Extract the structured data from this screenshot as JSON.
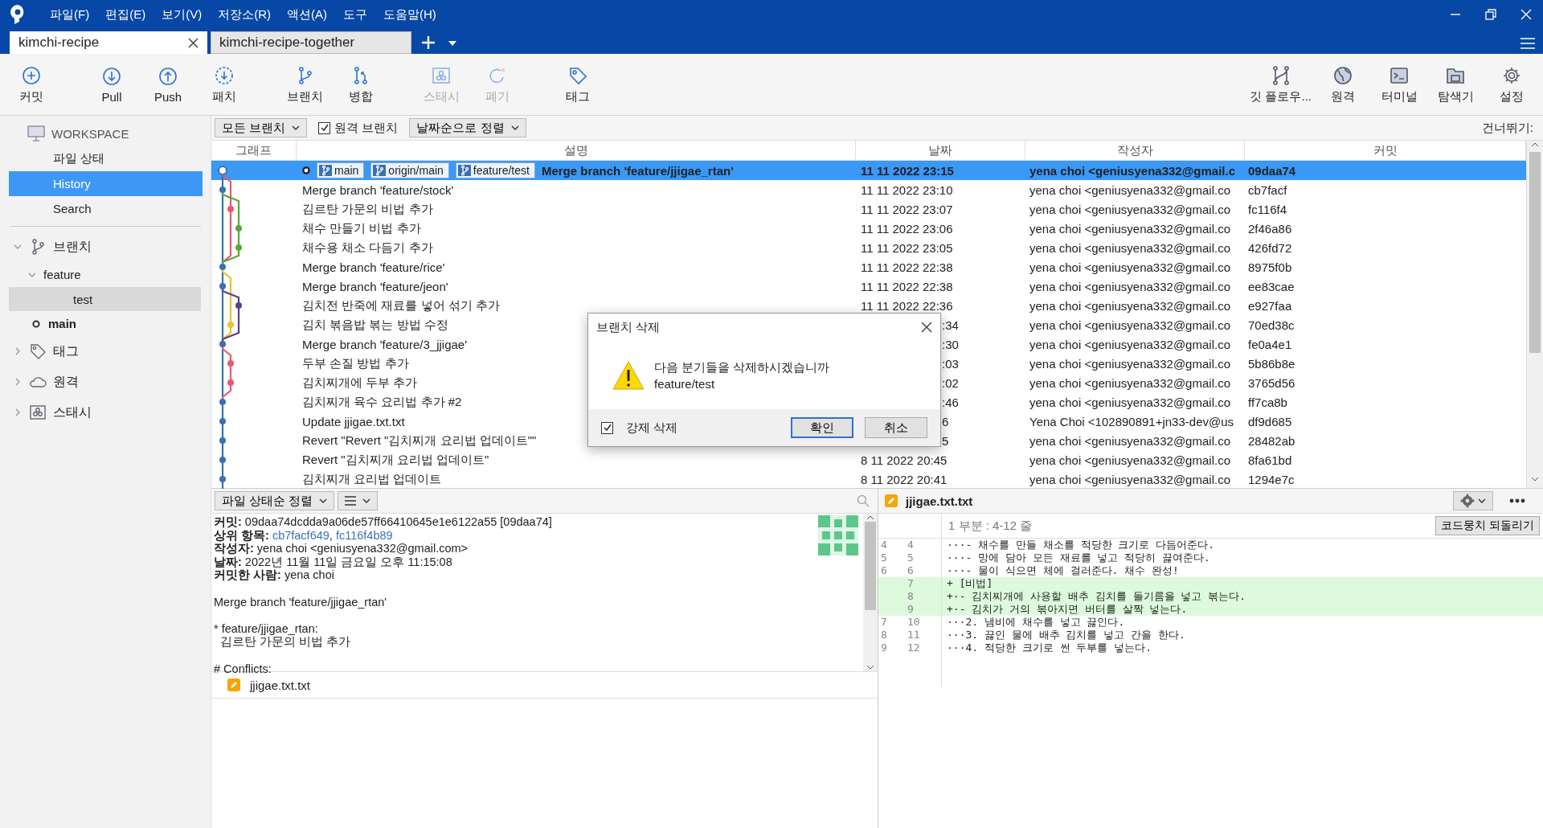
{
  "menu": [
    "파일(F)",
    "편집(E)",
    "보기(V)",
    "저장소(R)",
    "액션(A)",
    "도구",
    "도움말(H)"
  ],
  "tabs": [
    {
      "label": "kimchi-recipe",
      "selected": true
    },
    {
      "label": "kimchi-recipe-together",
      "selected": false
    }
  ],
  "toolbar_left": [
    {
      "label": "커밋",
      "disabled": false
    },
    {
      "label": "Pull",
      "disabled": false
    },
    {
      "label": "Push",
      "disabled": false
    },
    {
      "label": "패치",
      "disabled": false
    },
    {
      "label": "브랜치",
      "disabled": false
    },
    {
      "label": "병합",
      "disabled": false
    },
    {
      "label": "스태시",
      "disabled": true
    },
    {
      "label": "폐기",
      "disabled": true
    },
    {
      "label": "태그",
      "disabled": false
    }
  ],
  "toolbar_right": [
    {
      "label": "깃 플로우...",
      "disabled": false
    },
    {
      "label": "원격",
      "disabled": false
    },
    {
      "label": "터미널",
      "disabled": false
    },
    {
      "label": "탐색기",
      "disabled": false
    },
    {
      "label": "설정",
      "disabled": false
    }
  ],
  "sidebar": {
    "workspace": "WORKSPACE",
    "workspace_items": [
      {
        "label": "파일 상태",
        "selected": false
      },
      {
        "label": "History",
        "selected": true
      },
      {
        "label": "Search",
        "selected": false
      }
    ],
    "sections": [
      {
        "label": "브랜치",
        "expanded": true,
        "children": [
          {
            "label": "feature",
            "expanded": true,
            "children": [
              {
                "label": "test",
                "selected": true,
                "current": false
              }
            ]
          },
          {
            "label": "main",
            "selected": false,
            "current": true
          }
        ]
      },
      {
        "label": "태그",
        "expanded": false
      },
      {
        "label": "원격",
        "expanded": false
      },
      {
        "label": "스태시",
        "expanded": false
      }
    ]
  },
  "filters": {
    "branches": "모든 브랜치",
    "remote_branches": {
      "label": "원격 브랜치",
      "checked": true
    },
    "sort": "날짜순으로 정렬",
    "jump": "건너뛰기:"
  },
  "commits": {
    "columns": [
      "그래프",
      "설명",
      "날짜",
      "작성자",
      "커밋"
    ],
    "rows": [
      {
        "selected": true,
        "head": true,
        "refs": [
          "main",
          "origin/main",
          "feature/test"
        ],
        "message": "Merge branch 'feature/jjigae_rtan'",
        "date": "11 11 2022 23:15",
        "author": "yena choi <geniusyena332@gmail.c",
        "hash": "09daa74"
      },
      {
        "selected": false,
        "message": "Merge branch 'feature/stock'",
        "date": "11 11 2022 23:10",
        "author": "yena choi <geniusyena332@gmail.co",
        "hash": "cb7facf"
      },
      {
        "selected": false,
        "message": "김르탄 가문의 비법 추가",
        "date": "11 11 2022 23:07",
        "author": "yena choi <geniusyena332@gmail.co",
        "hash": "fc116f4"
      },
      {
        "selected": false,
        "message": "채수 만들기 비법 추가",
        "date": "11 11 2022 23:06",
        "author": "yena choi <geniusyena332@gmail.co",
        "hash": "2f46a86"
      },
      {
        "selected": false,
        "message": "채수용 채소 다듬기 추가",
        "date": "11 11 2022 23:05",
        "author": "yena choi <geniusyena332@gmail.co",
        "hash": "426fd72"
      },
      {
        "selected": false,
        "message": "Merge branch 'feature/rice'",
        "date": "11 11 2022 22:38",
        "author": "yena choi <geniusyena332@gmail.co",
        "hash": "8975f0b"
      },
      {
        "selected": false,
        "message": "Merge branch 'feature/jeon'",
        "date": "11 11 2022 22:38",
        "author": "yena choi <geniusyena332@gmail.co",
        "hash": "ee83cae"
      },
      {
        "selected": false,
        "message": "김치전 반죽에 재료를 넣어 섞기 추가",
        "date": "11 11 2022 22:36",
        "author": "yena choi <geniusyena332@gmail.co",
        "hash": "e927faa"
      },
      {
        "selected": false,
        "message": "김치 볶음밥 볶는 방법 수정",
        "date": ":34",
        "partial": true,
        "author": "yena choi <geniusyena332@gmail.co",
        "hash": "70ed38c"
      },
      {
        "selected": false,
        "message": "Merge branch 'feature/3_jjigae'",
        "date": ":30",
        "partial": true,
        "author": "yena choi <geniusyena332@gmail.co",
        "hash": "fe0a4e1"
      },
      {
        "selected": false,
        "message": "두부 손질 방법 추가",
        "date": ":03",
        "partial": true,
        "author": "yena choi <geniusyena332@gmail.co",
        "hash": "5b86b8e"
      },
      {
        "selected": false,
        "message": "김치찌개에 두부 추가",
        "date": ":02",
        "partial": true,
        "author": "yena choi <geniusyena332@gmail.co",
        "hash": "3765d56"
      },
      {
        "selected": false,
        "message": "김치찌개 육수 요리법 추가 #2",
        "date": ":46",
        "partial": true,
        "author": "yena choi <geniusyena332@gmail.co",
        "hash": "ff7ca8b"
      },
      {
        "selected": false,
        "message": "Update jjigae.txt.txt",
        "date": "6",
        "partial": true,
        "author": "Yena Choi <102890891+jn33-dev@us",
        "hash": "df9d685"
      },
      {
        "selected": false,
        "message": "Revert \"Revert \"김치찌개 요리법 업데이트\"\"",
        "date": "5",
        "partial": true,
        "author": "yena choi <geniusyena332@gmail.co",
        "hash": "28482ab"
      },
      {
        "selected": false,
        "message": "Revert \"김치찌개 요리법 업데이트\"",
        "date": "8 11 2022 20:45",
        "author": "yena choi <geniusyena332@gmail.co",
        "hash": "8fa61bd"
      },
      {
        "selected": false,
        "message": "김치찌개 요리법 업데이트",
        "date": "8 11 2022 20:41",
        "author": "yena choi <geniusyena332@gmail.co",
        "hash": "1294e7c"
      }
    ]
  },
  "details": {
    "sort": "파일 상태순 정렬",
    "lines": [
      "**커밋:** 09daa74dcdda9a06de57ff66410645e1e6122a55 [09daa74]"
    ],
    "parents_label": "상위 항목:",
    "parents": [
      "cb7facf649",
      "fc116f4b89"
    ],
    "parents_separator": ",",
    "lines_after": [
      "**작성자:** yena choi <geniusyena332@gmail.com>",
      "**날짜:** 2022년 11월 11일 금요일 오후 11:15:08",
      "**커밋한 사람:** yena choi"
    ],
    "message": [
      "Merge branch 'feature/jjigae_rtan'",
      "* feature/jjigae_rtan:",
      "  김르탄 가문의 비법 추가",
      "# Conflicts:"
    ],
    "files": [
      "jjigae.txt.txt"
    ]
  },
  "diff": {
    "file": "jjigae.txt.txt",
    "hunk": "1 부분 : 4-12 줄",
    "revert": "코드뭉치 되돌리기",
    "lines": [
      {
        "kind": "context",
        "old": "4",
        "new": "4",
        "text": "···- 채수를 만들 채소를 적당한 크기로 다듬어준다."
      },
      {
        "kind": "context",
        "old": "5",
        "new": "5",
        "text": "···- 망에 담아 모든 재료를 넣고 적당히 끓여준다."
      },
      {
        "kind": "context",
        "old": "6",
        "new": "6",
        "text": "···- 물이 식으면 체에 걸러준다. 채수 완성!"
      },
      {
        "kind": "added",
        "new": "7",
        "text": "+ [비법]"
      },
      {
        "kind": "added",
        "new": "8",
        "text": "+·- 김치찌개에 사용할 배추 김치를 들기름을 넣고 볶는다."
      },
      {
        "kind": "added",
        "new": "9",
        "text": "+·- 김치가 거의 볶아지면 버터를 살짝 넣는다."
      },
      {
        "kind": "context",
        "old": "7",
        "new": "10",
        "text": "···2. 냄비에 채수를 넣고 끓인다."
      },
      {
        "kind": "context",
        "old": "8",
        "new": "11",
        "text": "···3. 끓인 물에 배추 김치를 넣고 간을 한다."
      },
      {
        "kind": "context",
        "old": "9",
        "new": "12",
        "text": "···4. 적당한 크기로 썬 두부를 넣는다."
      }
    ]
  },
  "dialog": {
    "title": "브랜치 삭제",
    "message": "다음 분기들을 삭제하시겠습니까",
    "branch": "feature/test",
    "force": {
      "label": "강제 삭제",
      "checked": true
    },
    "buttons": [
      {
        "label": "확인",
        "primary": true
      },
      {
        "label": "취소",
        "primary": false
      }
    ]
  }
}
